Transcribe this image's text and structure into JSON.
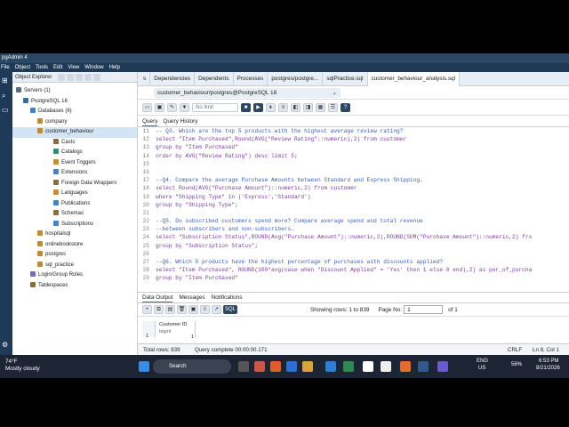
{
  "app": {
    "title": "pgAdmin 4"
  },
  "menu": [
    "File",
    "Object",
    "Tools",
    "Edit",
    "View",
    "Window",
    "Help"
  ],
  "explorer": {
    "title": "Object Explorer",
    "tree": [
      {
        "label": "Servers (1)",
        "indent": 4
      },
      {
        "label": "PostgreSQL 18",
        "indent": 12
      },
      {
        "label": "Databases (6)",
        "indent": 20
      },
      {
        "label": "company",
        "indent": 28
      },
      {
        "label": "customer_behaviour",
        "indent": 28,
        "selected": true
      },
      {
        "label": "Casts",
        "indent": 46
      },
      {
        "label": "Catalogs",
        "indent": 46
      },
      {
        "label": "Event Triggers",
        "indent": 46
      },
      {
        "label": "Extensions",
        "indent": 46
      },
      {
        "label": "Foreign Data Wrappers",
        "indent": 46
      },
      {
        "label": "Languages",
        "indent": 46
      },
      {
        "label": "Publications",
        "indent": 46
      },
      {
        "label": "Schemas",
        "indent": 46
      },
      {
        "label": "Subscriptions",
        "indent": 46
      },
      {
        "label": "hospitalsql",
        "indent": 28
      },
      {
        "label": "onlinebookstore",
        "indent": 28
      },
      {
        "label": "postgres",
        "indent": 28
      },
      {
        "label": "sql_practice",
        "indent": 28
      },
      {
        "label": "Login/Group Roles",
        "indent": 20
      },
      {
        "label": "Tablespaces",
        "indent": 20
      }
    ]
  },
  "tabs": [
    {
      "label": "s"
    },
    {
      "label": "Dependencies"
    },
    {
      "label": "Dependents"
    },
    {
      "label": "Processes"
    },
    {
      "label": "postgres/postgre..."
    },
    {
      "label": "sqlPractice.sql"
    },
    {
      "label": "customer_behaviour_analysis.sql",
      "active": true
    }
  ],
  "connection": "customer_behaviour/postgres@PostgreSQL 18",
  "toolbar": {
    "limit_label": "No limit"
  },
  "subtabs": {
    "query": "Query",
    "history": "Query History"
  },
  "editor_lines": [
    {
      "n": "11",
      "text": "-- Q3. Which are the top 5 products with the highest average review rating?"
    },
    {
      "n": "12",
      "text": "select \"Item Purchased\",Round(AVG(\"Review Rating\"::numeric),2) from customer"
    },
    {
      "n": "13",
      "text": "group by \"Item Purchased\""
    },
    {
      "n": "14",
      "text": "order by AVG(\"Review Rating\") desc limit 5;"
    },
    {
      "n": "15",
      "text": ""
    },
    {
      "n": "16",
      "text": ""
    },
    {
      "n": "17",
      "text": "--Q4. Compare the average Purchase Amounts between Standard and Express Shipping."
    },
    {
      "n": "18",
      "text": "select Round(AVG(\"Purchase Amount\")::numeric,2) from customer"
    },
    {
      "n": "19",
      "text": "where \"Shipping Type\" in ('Express','Standard')"
    },
    {
      "n": "20",
      "text": "group by \"Shipping Type\";"
    },
    {
      "n": "21",
      "text": ""
    },
    {
      "n": "22",
      "text": "--Q5. Do subscribed customers spend more? Compare average spend and total revenue"
    },
    {
      "n": "23",
      "text": "--between subscribers and non-subscribers."
    },
    {
      "n": "24",
      "text": "select \"Subscription Status\",ROUND(Avg(\"Purchase Amount\")::numeric,2),ROUND(SUM(\"Purchase Amount\")::numeric,2) fro"
    },
    {
      "n": "25",
      "text": "group by \"Subscription Status\";"
    },
    {
      "n": "26",
      "text": ""
    },
    {
      "n": "27",
      "text": "--Q6. Which 5 products have the highest percentage of purchases with discounts applied?"
    },
    {
      "n": "28",
      "text": "select \"Item Purchased\", ROUND(100*avg(case when \"Discount Applied\" = 'Yes' then 1 else 0 end),2) as per_of_purcha"
    },
    {
      "n": "29",
      "text": "group by \"Item Purchased\""
    }
  ],
  "data_panel": {
    "tabs": [
      "Data Output",
      "Messages",
      "Notifications"
    ],
    "rows_info": "Showing rows: 1 to 839",
    "page_label": "Page No:",
    "page_value": "1",
    "page_of": "of 1",
    "column_header": "Customer ID",
    "column_type": "bigint",
    "first_row_no": "1",
    "first_cell": "1"
  },
  "status": {
    "total_rows": "Total rows: 839",
    "query_complete": "Query complete 00:00:00.171",
    "line_ending": "CRLF",
    "position": "Ln 8, Col 1"
  },
  "taskbar": {
    "weather_temp": "74°F",
    "weather_desc": "Mostly cloudy",
    "search": "Search",
    "lang": "ENG",
    "region": "US",
    "battery": "56%",
    "time": "6:53 PM",
    "date": "8/21/2026"
  }
}
